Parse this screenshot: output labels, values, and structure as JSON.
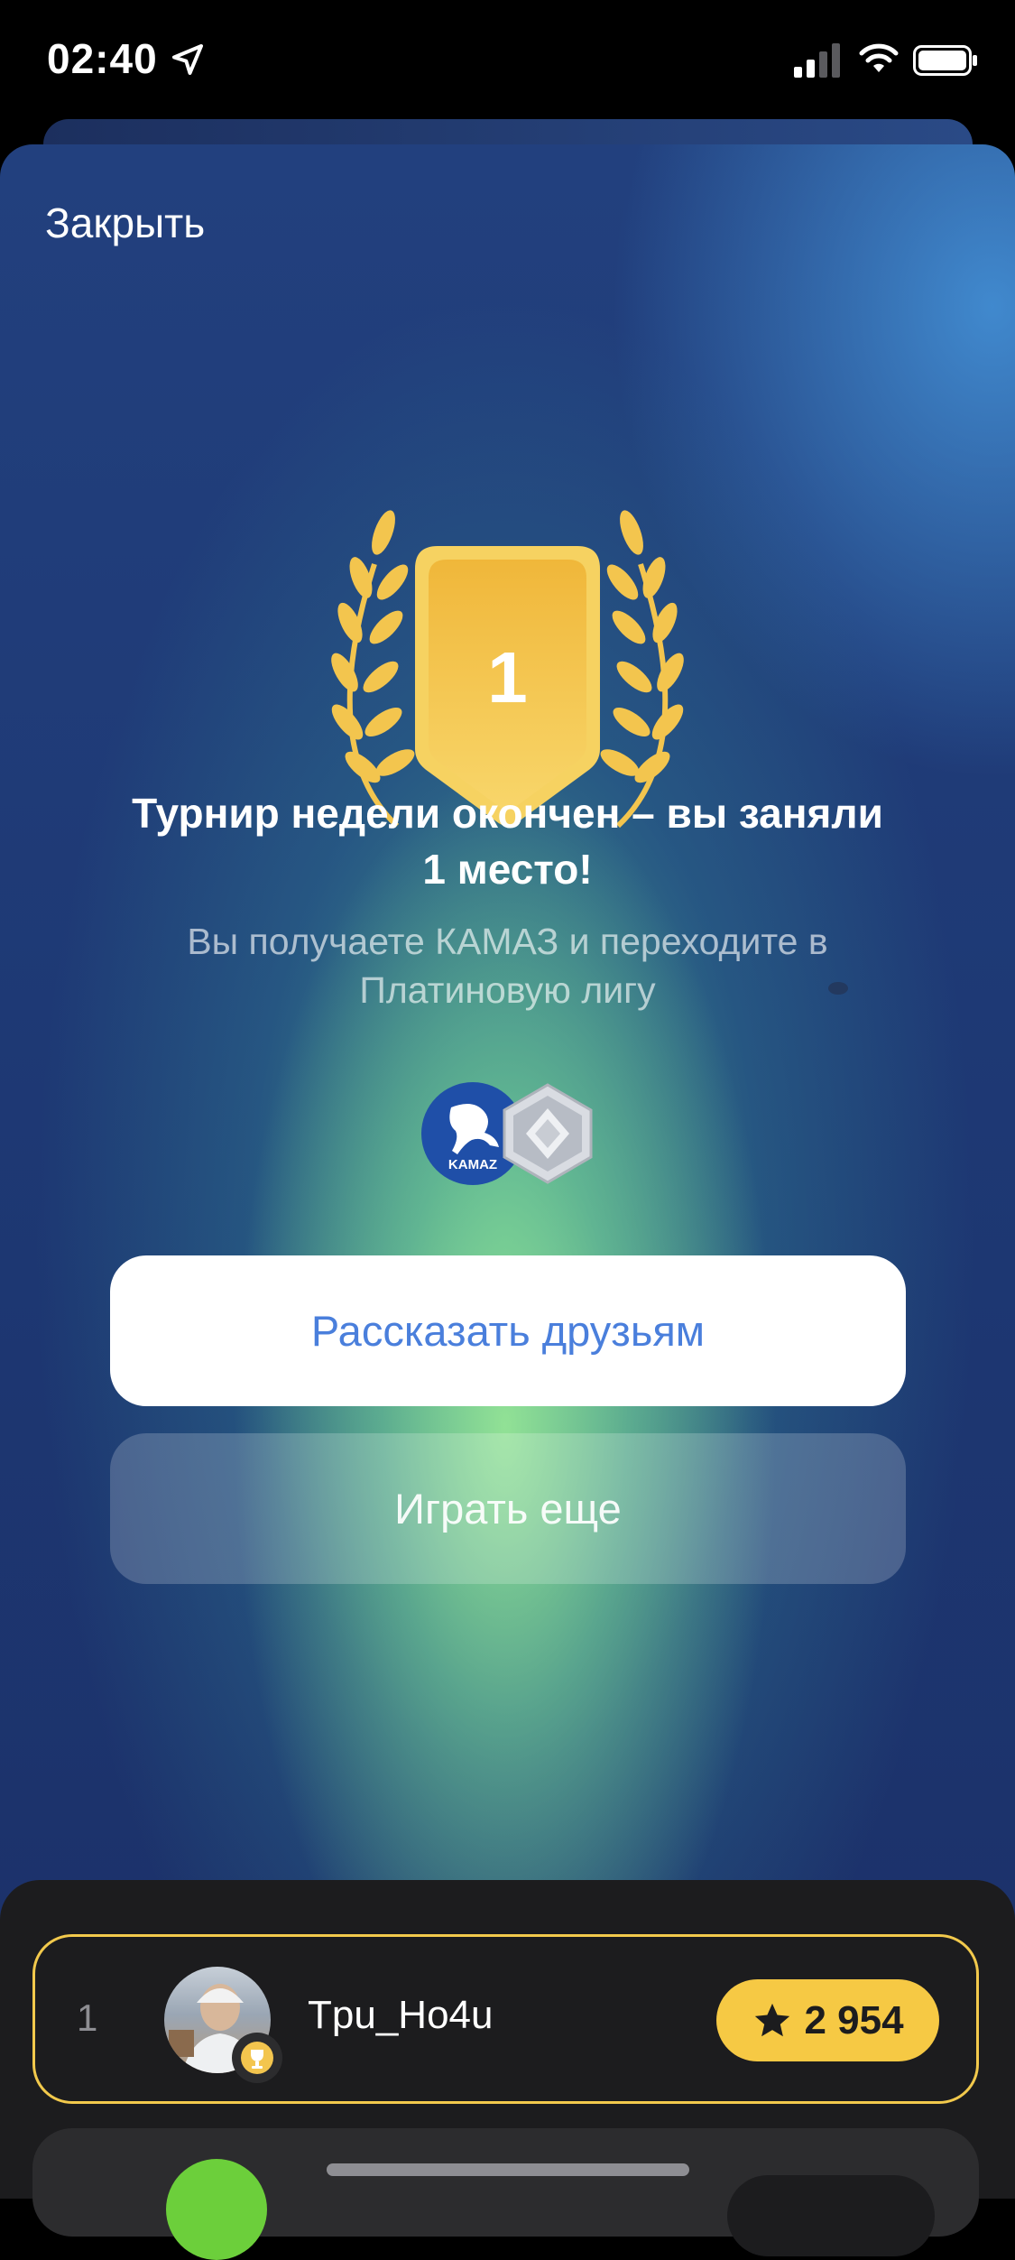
{
  "status_bar": {
    "time": "02:40",
    "icons": [
      "location-arrow-icon",
      "signal-icon",
      "wifi-icon",
      "battery-icon"
    ]
  },
  "modal": {
    "close_label": "Закрыть",
    "place_number": "1",
    "title": "Турнир недели окончен – вы заняли 1 место!",
    "subtitle": "Вы получаете КАМАЗ и переходите в Платиновую лигу",
    "rewards": [
      {
        "name": "kamaz-logo",
        "logo_text": "KAMAZ"
      },
      {
        "name": "platinum-league-icon"
      }
    ],
    "share_button": "Рассказать друзьям",
    "play_again_button": "Играть еще"
  },
  "leaderboard": {
    "rows": [
      {
        "rank": "1",
        "username": "Tpu_Ho4u",
        "score": "2 954",
        "highlight": true
      }
    ]
  },
  "colors": {
    "accent_gold": "#F6C944",
    "share_text": "#4A7FDC",
    "panel_bg": "#1C1C1E"
  }
}
